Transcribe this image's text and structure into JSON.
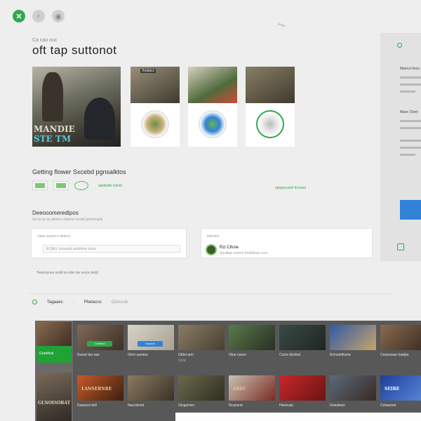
{
  "colors": {
    "accent": "#2fa84f",
    "blue": "#2f82d8",
    "band": "#585858"
  },
  "top_icons": [
    "xbox-logo-icon",
    "search-icon",
    "controller-icon"
  ],
  "header": {
    "eyebrow": "Ca cao ouc",
    "title": "oft tap suttonot"
  },
  "featured": {
    "big_title_1": "MANDIE",
    "big_title_2": "STE TM",
    "cards": [
      {
        "tag": "Xoatacc"
      },
      {
        "tag": ""
      },
      {
        "tag": ""
      }
    ]
  },
  "collections": {
    "title": "Getting flower Sxcebd pgnsalktos",
    "chip_caption": "alsidwlbr Glsrid",
    "link": "opsgecusiel tlosraol"
  },
  "account": {
    "title": "Deeooomeredtpos",
    "subtitle": "Ge la oy oo aimsm cirplouo xexidl giumrsupsi",
    "card1_label": "ciuke acrpel s drdess",
    "card1_input": "ECAEL tocuutsd sudtnitoo tocur",
    "card2_label": "teloutes",
    "card2_name": "Rzi Cihsie",
    "card2_sub": "Socittae zonroz lrosbdcan ccor",
    "note": "Teamsyceu sodd ia nrde ioe socia ondd"
  },
  "tabs": {
    "items": [
      "Tagaaes",
      "Phetacos",
      "Ocirccolt"
    ]
  },
  "side_panel": {
    "head1": "Maecsi bxou",
    "head2": "Maec Cleet"
  },
  "store": {
    "left_cta": "Graddcal",
    "left_title": "GLNOISORAT",
    "row1": [
      {
        "label": "Ganet dar eae",
        "price": "",
        "btn": "Cnseaol",
        "btn_color": "green"
      },
      {
        "label": "Ghrn aasrioe",
        "price": "",
        "btn": "Daacus",
        "btn_color": "blue"
      },
      {
        "label": "Ofdel arm",
        "price": "Ccnc",
        "btn": "",
        "btn_color": ""
      },
      {
        "label": "Olue eoure",
        "price": "",
        "btn": "",
        "btn_color": ""
      },
      {
        "label": "Ccine dicelnd",
        "price": "",
        "btn": "",
        "btn_color": ""
      },
      {
        "label": "Rcinstelfssrte",
        "price": "",
        "btn": "",
        "btn_color": ""
      },
      {
        "label": "Ceaosoaer lsadpe",
        "price": "",
        "btn": "",
        "btn_color": ""
      }
    ],
    "row2": [
      {
        "label": "Ganeuct dsll",
        "art_text": "LANSERNRE"
      },
      {
        "label": "Naccdsrlst",
        "art_text": ""
      },
      {
        "label": "Oicgarnen",
        "art_text": ""
      },
      {
        "label": "Ncaosrst",
        "art_text": "AREC"
      },
      {
        "label": "Heeeuas",
        "art_text": ""
      },
      {
        "label": "Gneatees",
        "art_text": ""
      },
      {
        "label": "Cetuassnt",
        "art_text": "SEIRE"
      }
    ]
  }
}
